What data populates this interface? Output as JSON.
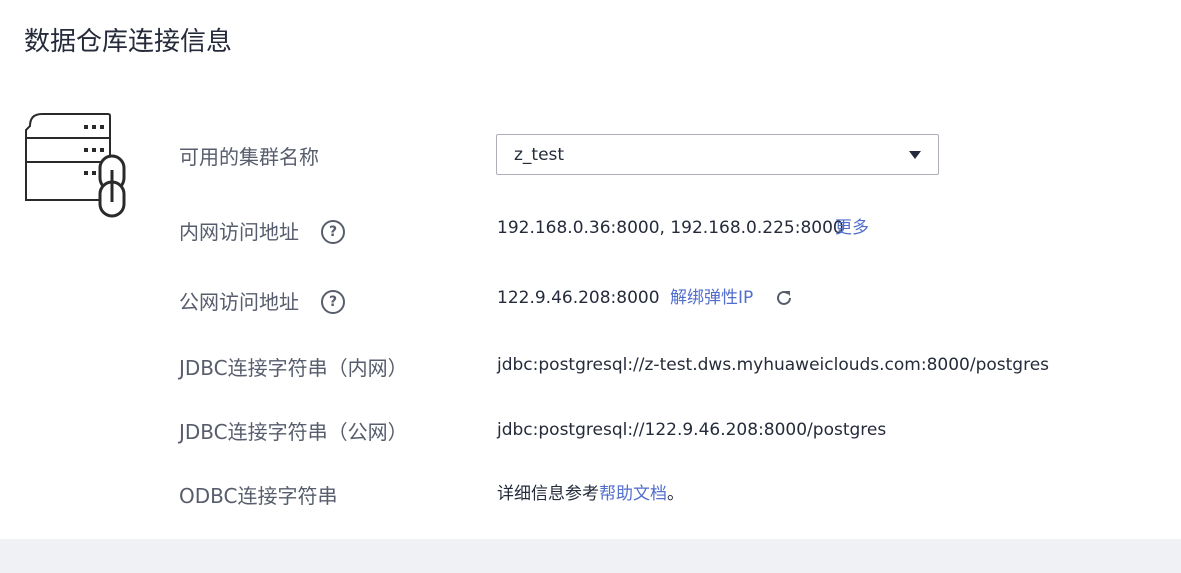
{
  "page": {
    "title": "数据仓库连接信息"
  },
  "icons": {
    "server": "server-link-icon",
    "help": "question-circle-icon",
    "refresh": "refresh-icon",
    "caret": "caret-down-icon"
  },
  "help_glyph": "?",
  "cluster": {
    "label": "可用的集群名称",
    "selected": "z_test"
  },
  "private_address": {
    "label": "内网访问地址",
    "value": "192.168.0.36:8000, 192.168.0.225:8000",
    "more_link": "更多"
  },
  "public_address": {
    "label": "公网访问地址",
    "value": "122.9.46.208:8000",
    "unbind_link": "解绑弹性IP"
  },
  "jdbc_private": {
    "label": "JDBC连接字符串（内网）",
    "value": "jdbc:postgresql://z-test.dws.myhuaweiclouds.com:8000/postgres"
  },
  "jdbc_public": {
    "label": "JDBC连接字符串（公网）",
    "value": "jdbc:postgresql://122.9.46.208:8000/postgres"
  },
  "odbc": {
    "label": "ODBC连接字符串",
    "prefix": "详细信息参考",
    "doc_link": "帮助文档",
    "suffix": "。"
  },
  "colors": {
    "text": "#252b3a",
    "label": "#575d6c",
    "link": "#526ecc",
    "footer": "#f0f1f5"
  }
}
